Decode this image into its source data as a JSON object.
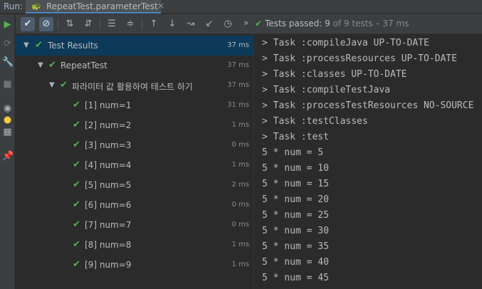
{
  "run_bar": {
    "label": "Run:",
    "tab_title": "RepeatTest.parameterTest",
    "close_glyph": "×"
  },
  "gutter": {
    "icons": [
      "rerun-icon",
      "rerun-failed-icon",
      "wrench-icon",
      "stop-icon",
      "eye-icon",
      "bulb-icon",
      "layout-icon",
      "pin-icon"
    ]
  },
  "toolbar": {
    "icons": [
      "show-passed-icon",
      "show-ignored-icon",
      "sort-alpha-icon",
      "sort-duration-icon",
      "expand-all-icon",
      "collapse-all-icon",
      "prev-failed-icon",
      "next-failed-icon",
      "import-tests-icon",
      "export-icon",
      "history-icon"
    ],
    "more": "»",
    "status_prefix": "Tests passed: ",
    "status_count": "9",
    "status_suffix": " of 9 tests – 37 ms"
  },
  "tree": {
    "root": {
      "label": "Test Results",
      "time": "37 ms"
    },
    "class_node": {
      "label": "RepeatTest",
      "time": "37 ms"
    },
    "method_node": {
      "label": "파라미터 값 활용하여 테스트 하기",
      "time": "37 ms"
    },
    "items": [
      {
        "label": "[1] num=1",
        "time": "31 ms"
      },
      {
        "label": "[2] num=2",
        "time": "1 ms"
      },
      {
        "label": "[3] num=3",
        "time": "0 ms"
      },
      {
        "label": "[4] num=4",
        "time": "1 ms"
      },
      {
        "label": "[5] num=5",
        "time": "2 ms"
      },
      {
        "label": "[6] num=6",
        "time": "0 ms"
      },
      {
        "label": "[7] num=7",
        "time": "0 ms"
      },
      {
        "label": "[8] num=8",
        "time": "1 ms"
      },
      {
        "label": "[9] num=9",
        "time": "1 ms"
      }
    ]
  },
  "console": {
    "lines": [
      "> Task :compileJava UP-TO-DATE",
      "> Task :processResources UP-TO-DATE",
      "> Task :classes UP-TO-DATE",
      "> Task :compileTestJava",
      "> Task :processTestResources NO-SOURCE",
      "> Task :testClasses",
      "> Task :test",
      "5 * num = 5",
      "5 * num = 10",
      "5 * num = 15",
      "5 * num = 20",
      "5 * num = 25",
      "5 * num = 30",
      "5 * num = 35",
      "5 * num = 40",
      "5 * num = 45"
    ]
  },
  "colors": {
    "pass": "#4fb351",
    "selected_row": "#0d3a58",
    "background": "#2b2b2b",
    "panel": "#3c3f41"
  }
}
